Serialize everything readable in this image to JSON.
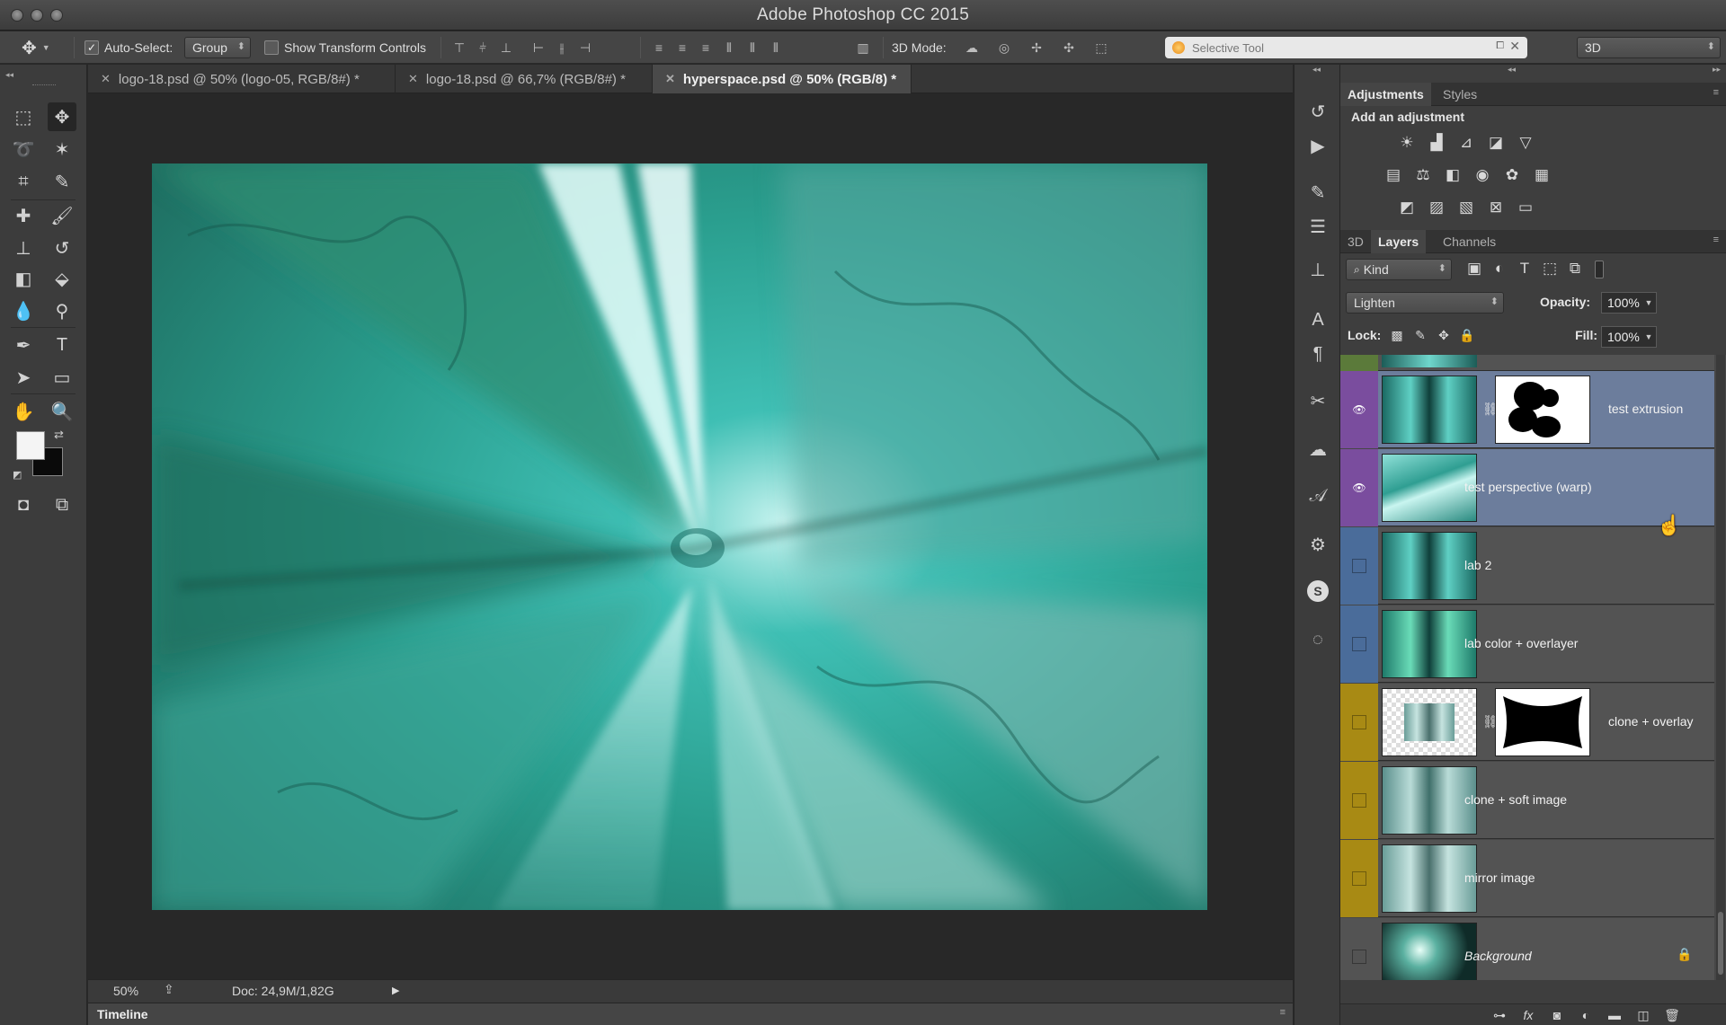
{
  "app": {
    "title": "Adobe Photoshop CC 2015"
  },
  "options_bar": {
    "auto_select_label": "Auto-Select:",
    "auto_select_checked": true,
    "auto_select_value": "Group",
    "show_transform_label": "Show Transform Controls",
    "show_transform_checked": false,
    "mode_3d_label": "3D Mode:",
    "search_value": "Selective Tool",
    "workspace_value": "3D"
  },
  "tabs": [
    {
      "label": "logo-18.psd @ 50% (logo-05, RGB/8#) *",
      "active": false
    },
    {
      "label": "logo-18.psd @ 66,7% (RGB/8#) *",
      "active": false
    },
    {
      "label": "hyperspace.psd @ 50% (RGB/8) *",
      "active": true
    }
  ],
  "status": {
    "zoom": "50%",
    "doc": "Doc: 24,9M/1,82G"
  },
  "timeline": {
    "label": "Timeline"
  },
  "adjustments": {
    "tabs": [
      "Adjustments",
      "Styles"
    ],
    "heading": "Add an adjustment"
  },
  "layers_panel": {
    "tabs": [
      "3D",
      "Layers",
      "Channels"
    ],
    "kind_filter": "Kind",
    "blend_mode": "Lighten",
    "opacity_label": "Opacity:",
    "opacity_value": "100%",
    "lock_label": "Lock:",
    "fill_label": "Fill:",
    "fill_value": "100%"
  },
  "layers": [
    {
      "name": "test extrusion",
      "visible": true,
      "selected": true,
      "color": "#7a4d9e",
      "has_mask": true
    },
    {
      "name": "test perspective (warp)",
      "visible": true,
      "selected": true,
      "color": "#7a4d9e",
      "has_mask": false
    },
    {
      "name": "lab 2",
      "visible": false,
      "selected": false,
      "color": "#4a6c9a",
      "has_mask": false
    },
    {
      "name": "lab color + overlayer",
      "visible": false,
      "selected": false,
      "color": "#4a6c9a",
      "has_mask": false
    },
    {
      "name": "clone + overlay",
      "visible": false,
      "selected": false,
      "color": "#a88a14",
      "has_mask": true
    },
    {
      "name": "clone + soft image",
      "visible": false,
      "selected": false,
      "color": "#a88a14",
      "has_mask": false
    },
    {
      "name": "mirror image",
      "visible": false,
      "selected": false,
      "color": "#a88a14",
      "has_mask": false
    },
    {
      "name": "Background",
      "visible": false,
      "selected": false,
      "color": "#535353",
      "has_mask": false,
      "locked": true
    }
  ]
}
